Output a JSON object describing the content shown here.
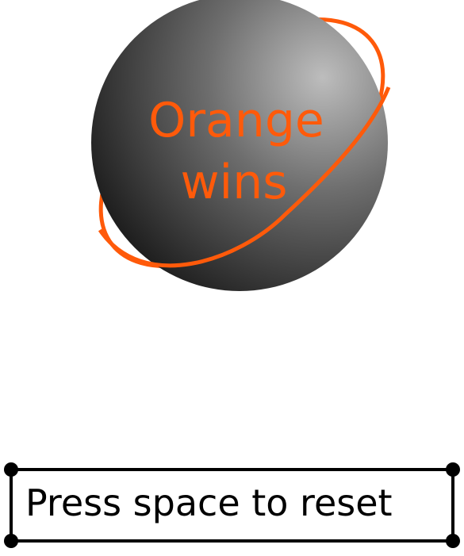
{
  "game": {
    "result_line1": "Orange",
    "result_line2": "wins",
    "winner_color": "#ff5a0a",
    "reset_prompt": "Press space to reset"
  },
  "colors": {
    "planet_light": "#b9b9b9",
    "planet_mid": "#6e6e6e",
    "planet_dark": "#1f1f1f",
    "frame": "#000000",
    "background": "#ffffff"
  }
}
